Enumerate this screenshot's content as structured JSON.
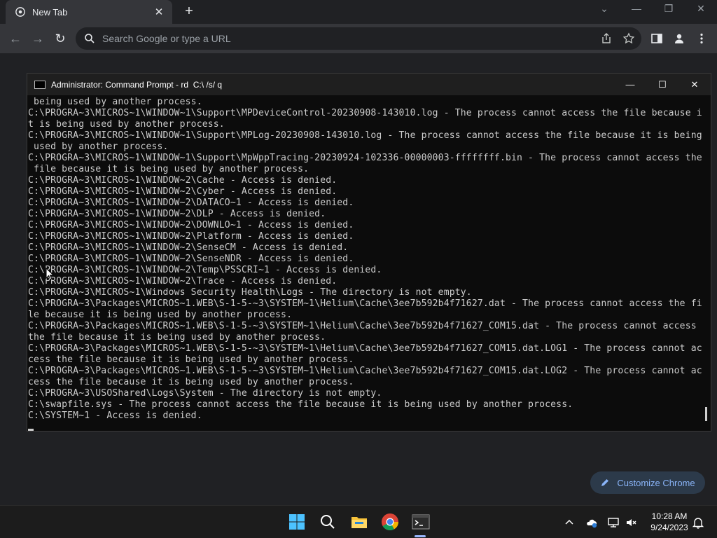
{
  "browser": {
    "tab_title": "New Tab",
    "omnibox_placeholder": "Search Google or type a URL",
    "customize_label": "Customize Chrome"
  },
  "cmd": {
    "title": "Administrator: Command Prompt - rd  C:\\ /s/ q",
    "lines": [
      " being used by another process.",
      "C:\\PROGRA~3\\MICROS~1\\WINDOW~1\\Support\\MPDeviceControl-20230908-143010.log - The process cannot access the file because i",
      "t is being used by another process.",
      "C:\\PROGRA~3\\MICROS~1\\WINDOW~1\\Support\\MPLog-20230908-143010.log - The process cannot access the file because it is being",
      " used by another process.",
      "C:\\PROGRA~3\\MICROS~1\\WINDOW~1\\Support\\MpWppTracing-20230924-102336-00000003-ffffffff.bin - The process cannot access the",
      " file because it is being used by another process.",
      "C:\\PROGRA~3\\MICROS~1\\WINDOW~2\\Cache - Access is denied.",
      "C:\\PROGRA~3\\MICROS~1\\WINDOW~2\\Cyber - Access is denied.",
      "C:\\PROGRA~3\\MICROS~1\\WINDOW~2\\DATACO~1 - Access is denied.",
      "C:\\PROGRA~3\\MICROS~1\\WINDOW~2\\DLP - Access is denied.",
      "C:\\PROGRA~3\\MICROS~1\\WINDOW~2\\DOWNLO~1 - Access is denied.",
      "C:\\PROGRA~3\\MICROS~1\\WINDOW~2\\Platform - Access is denied.",
      "C:\\PROGRA~3\\MICROS~1\\WINDOW~2\\SenseCM - Access is denied.",
      "C:\\PROGRA~3\\MICROS~1\\WINDOW~2\\SenseNDR - Access is denied.",
      "C:\\PROGRA~3\\MICROS~1\\WINDOW~2\\Temp\\PSSCRI~1 - Access is denied.",
      "C:\\PROGRA~3\\MICROS~1\\WINDOW~2\\Trace - Access is denied.",
      "C:\\PROGRA~3\\MICROS~1\\Windows Security Health\\Logs - The directory is not empty.",
      "C:\\PROGRA~3\\Packages\\MICROS~1.WEB\\S-1-5-~3\\SYSTEM~1\\Helium\\Cache\\3ee7b592b4f71627.dat - The process cannot access the fi",
      "le because it is being used by another process.",
      "C:\\PROGRA~3\\Packages\\MICROS~1.WEB\\S-1-5-~3\\SYSTEM~1\\Helium\\Cache\\3ee7b592b4f71627_COM15.dat - The process cannot access",
      "the file because it is being used by another process.",
      "C:\\PROGRA~3\\Packages\\MICROS~1.WEB\\S-1-5-~3\\SYSTEM~1\\Helium\\Cache\\3ee7b592b4f71627_COM15.dat.LOG1 - The process cannot ac",
      "cess the file because it is being used by another process.",
      "C:\\PROGRA~3\\Packages\\MICROS~1.WEB\\S-1-5-~3\\SYSTEM~1\\Helium\\Cache\\3ee7b592b4f71627_COM15.dat.LOG2 - The process cannot ac",
      "cess the file because it is being used by another process.",
      "C:\\PROGRA~3\\USOShared\\Logs\\System - The directory is not empty.",
      "C:\\swapfile.sys - The process cannot access the file because it is being used by another process.",
      "C:\\SYSTEM~1 - Access is denied."
    ]
  },
  "taskbar": {
    "time": "10:28 AM",
    "date": "9/24/2023"
  },
  "colors": {
    "accent": "#8ab4f8",
    "console_text": "#cccccc",
    "console_bg": "#0c0c0c"
  }
}
